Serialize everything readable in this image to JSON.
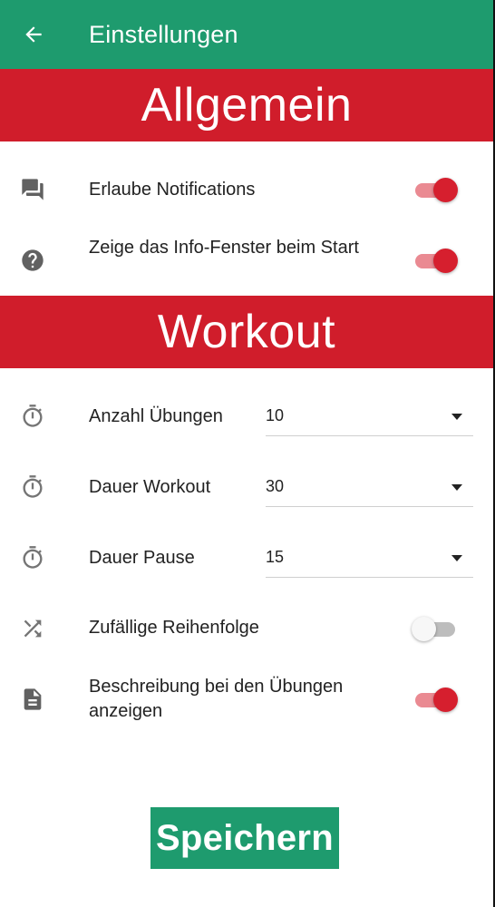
{
  "appbar": {
    "title": "Einstellungen",
    "back_icon": "arrow-left-icon"
  },
  "colors": {
    "primary": "#1e9b6e",
    "section": "#d01d2b",
    "toggle_on": "#d61f2e"
  },
  "sections": {
    "general": "Allgemein",
    "workout": "Workout"
  },
  "general": {
    "notifications": {
      "label": "Erlaube Notifications",
      "icon": "chat-icon",
      "on": true
    },
    "info_window": {
      "label": "Zeige das Info-Fenster beim Start",
      "icon": "help-icon",
      "on": true
    }
  },
  "workout": {
    "exercise_count": {
      "label": "Anzahl Übungen",
      "icon": "timer-icon",
      "value": "10"
    },
    "duration": {
      "label": "Dauer Workout",
      "icon": "timer-icon",
      "value": "30"
    },
    "pause": {
      "label": "Dauer Pause",
      "icon": "timer-icon",
      "value": "15"
    },
    "random_order": {
      "label": "Zufällige Reihenfolge",
      "icon": "shuffle-icon",
      "on": false
    },
    "show_description": {
      "label": "Beschreibung bei den Übungen anzeigen",
      "icon": "document-icon",
      "on": true
    }
  },
  "save_label": "Speichern"
}
